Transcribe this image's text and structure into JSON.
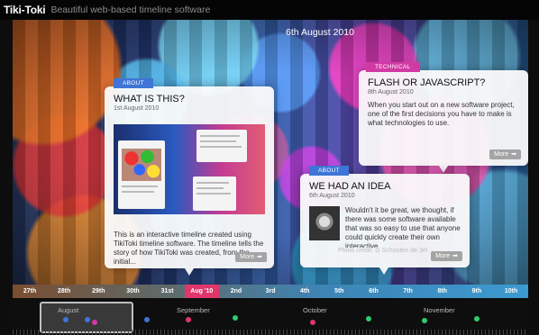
{
  "app": {
    "brand": "Tiki-Toki",
    "tagline": "Beautiful web-based timeline software"
  },
  "current_date": "6th August 2010",
  "cards": [
    {
      "category": "ABOUT",
      "category_color": "#3e75d6",
      "title": "WHAT IS THIS?",
      "date": "1st August 2010",
      "body": "This is an interactive timeline created using TikiToki timeline software. The timeline tells the story of how TikiToki was created, from the initial...",
      "more_label": "More"
    },
    {
      "category": "TECHNICAL",
      "category_color": "#d23aa3",
      "title": "FLASH OR JAVASCRIPT?",
      "date": "8th August 2010",
      "body": "When you start out on a new software project, one of the first decisions you have to make is what technologies to use.",
      "more_label": "More"
    },
    {
      "category": "ABOUT",
      "category_color": "#3e75d6",
      "title": "WE HAD AN IDEA",
      "date": "6th August 2010",
      "body": "Wouldn't it be great, we thought, if there was some software available that was so easy to use that anyone could quickly create their own interactive...",
      "more_label": "More",
      "credit": "Photo credit: G Schouten de Jel"
    }
  ],
  "days": [
    "27th",
    "28th",
    "29th",
    "30th",
    "31st",
    "Aug '10",
    "2nd",
    "3rd",
    "4th",
    "5th",
    "6th",
    "7th",
    "8th",
    "9th",
    "10th"
  ],
  "active_day": "Aug '10",
  "months": [
    "August",
    "September",
    "October",
    "November"
  ],
  "colors": {
    "about": "#3e75d6",
    "technical": "#d23aa3",
    "active_day": "#e0366b",
    "event_green": "#2ecc71"
  }
}
